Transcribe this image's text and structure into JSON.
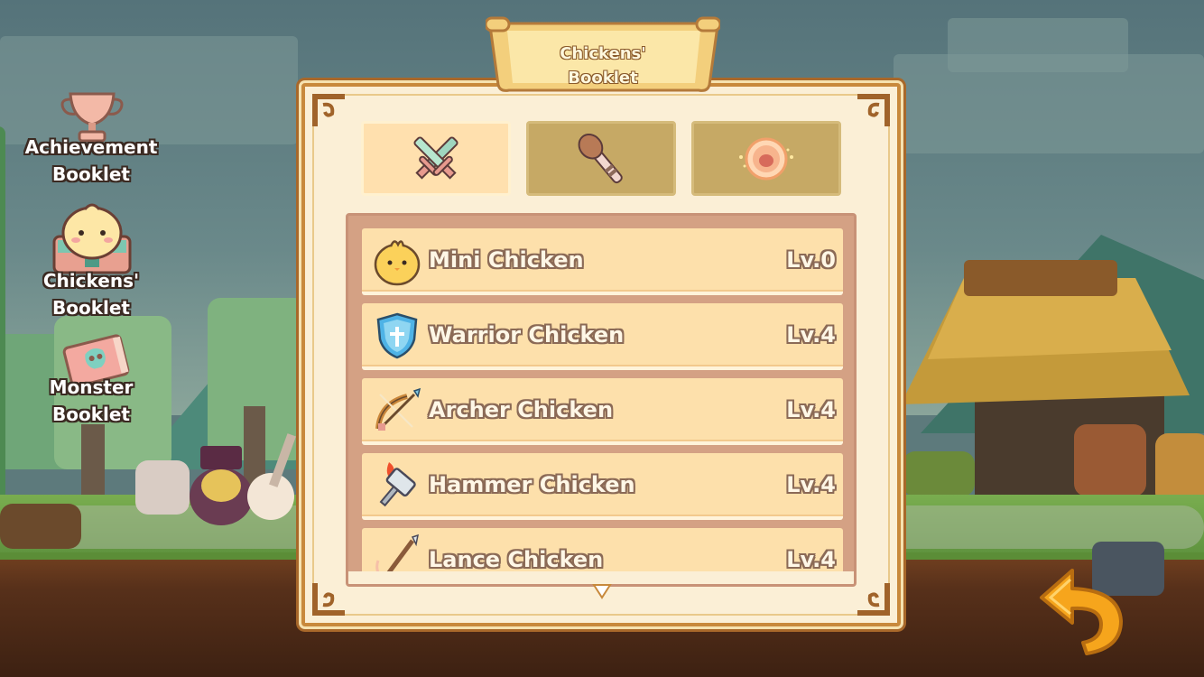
{
  "title": "Chickens'\nBooklet",
  "side_menu": [
    {
      "label": "Achievement\nBooklet",
      "icon": "trophy-icon"
    },
    {
      "label": "Chickens'\nBooklet",
      "icon": "chicken-book-icon"
    },
    {
      "label": "Monster\nBooklet",
      "icon": "monster-book-icon"
    }
  ],
  "tabs": [
    {
      "icon": "crossed-swords-icon",
      "active": true
    },
    {
      "icon": "club-staff-icon",
      "active": false
    },
    {
      "icon": "meat-orb-icon",
      "active": false
    }
  ],
  "chickens": [
    {
      "name": "Mini Chicken",
      "level": "Lv.0",
      "icon": "mini-chick-icon"
    },
    {
      "name": "Warrior Chicken",
      "level": "Lv.4",
      "icon": "shield-icon"
    },
    {
      "name": "Archer Chicken",
      "level": "Lv.4",
      "icon": "crossbow-icon"
    },
    {
      "name": "Hammer Chicken",
      "level": "Lv.4",
      "icon": "flaming-hammer-icon"
    },
    {
      "name": "Lance Chicken",
      "level": "Lv.4",
      "icon": "lance-icon"
    }
  ],
  "buttons": {
    "back": "back-arrow-icon"
  },
  "colors": {
    "panel_bg": "#fbefd6",
    "row_bg": "#fde0ab",
    "list_bg": "#d4a184",
    "tab_active": "#ffe0ae",
    "tab_inactive": "#c6a965",
    "back_arrow": "#f6a51c"
  }
}
